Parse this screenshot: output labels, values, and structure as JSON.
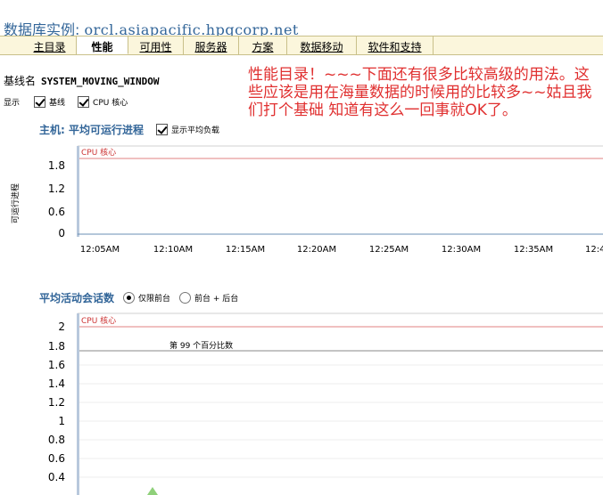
{
  "header": {
    "label": "数据库实例:",
    "instance": "orcl.asiapacific.hpqcorp.net"
  },
  "tabs": [
    {
      "label": "主目录",
      "active": false
    },
    {
      "label": "性能",
      "active": true
    },
    {
      "label": "可用性",
      "active": false
    },
    {
      "label": "服务器",
      "active": false
    },
    {
      "label": "方案",
      "active": false
    },
    {
      "label": "数据移动",
      "active": false
    },
    {
      "label": "软件和支持",
      "active": false
    }
  ],
  "baseline": {
    "label": "基线名",
    "value": "SYSTEM_MOVING_WINDOW"
  },
  "annotation": "性能目录！~~~下面还有很多比较高级的用法。这些应该是用在海量数据的时候用的比较多~~姑且我们打个基础 知道有这么一回事就OK了。",
  "display": {
    "label": "显示",
    "baseline_label": "基线",
    "cpu_label": "CPU 核心"
  },
  "colors": {
    "accent": "#336699",
    "tab_bg": "#fbf6dc",
    "annotation": "#e03030",
    "cpu_line": "#e08080",
    "marker": "#8fd07a"
  },
  "chart1_section": {
    "title": "主机: 平均可运行进程",
    "option": "显示平均负载",
    "ylabel": "可运行进程"
  },
  "chart2_section": {
    "title": "平均活动会话数",
    "radio1": "仅限前台",
    "radio2": "前台 + 后台"
  },
  "chart_data": [
    {
      "type": "line",
      "title": "主机: 平均可运行进程",
      "ylabel": "可运行进程",
      "yticks": [
        "1.8",
        "1.2",
        "0.6",
        "0"
      ],
      "ylim": [
        0,
        2.1
      ],
      "xticks": [
        "12:05AM",
        "12:10AM",
        "12:15AM",
        "12:20AM",
        "12:25AM",
        "12:30AM",
        "12:35AM",
        "12:4"
      ],
      "legend_label": "CPU 核心",
      "series": [
        {
          "name": "CPU 核心",
          "values": []
        }
      ],
      "grid": false
    },
    {
      "type": "line",
      "title": "平均活动会话数",
      "yticks": [
        "2",
        "1.8",
        "1.6",
        "1.4",
        "1.2",
        "1",
        "0.8",
        "0.6",
        "0.4"
      ],
      "ylim": [
        0.4,
        2
      ],
      "legend_label": "CPU 核心",
      "annotation": "第 99 个百分比数",
      "reference_line": 1.75,
      "series": [
        {
          "name": "CPU 核心",
          "values": []
        }
      ],
      "grid": true
    }
  ]
}
